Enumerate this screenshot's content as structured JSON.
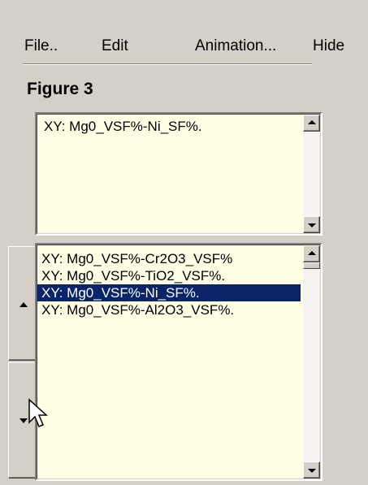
{
  "menu": {
    "file": "File..",
    "edit": "Edit",
    "animation": "Animation...",
    "hide": "Hide"
  },
  "figure_title": "Figure 3",
  "current_plot": {
    "text": "XY: Mg0_VSF%-Ni_SF%."
  },
  "plot_list": {
    "items": [
      "XY: Mg0_VSF%-Cr2O3_VSF%",
      "XY: Mg0_VSF%-TiO2_VSF%.",
      "XY: Mg0_VSF%-Ni_SF%.",
      "XY: Mg0_VSF%-Al2O3_VSF%."
    ],
    "selected_index": 2
  },
  "colors": {
    "window_bg": "#d4d0c8",
    "field_bg": "#ffffe6",
    "selection_bg": "#0a246a",
    "selection_fg": "#ffffff"
  },
  "icons": {
    "move_up": "triangle-up-icon",
    "move_down": "triangle-down-icon",
    "cursor": "mouse-pointer-icon"
  }
}
